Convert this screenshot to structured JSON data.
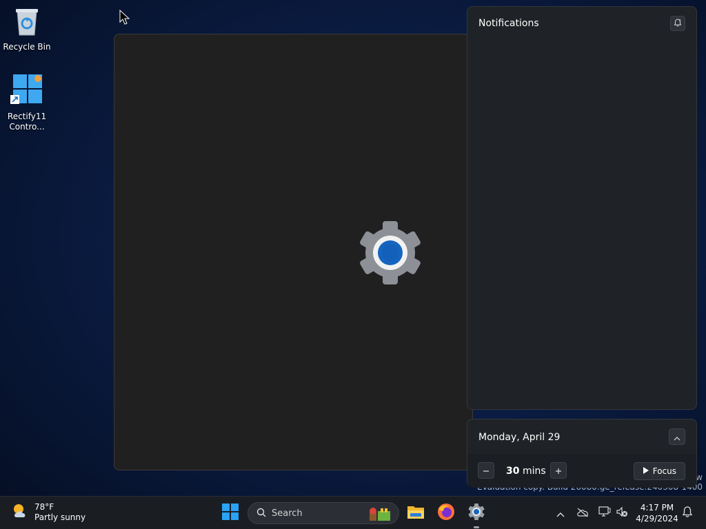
{
  "desktop": {
    "icons": [
      {
        "label": "Recycle Bin",
        "icon": "recycle-bin-icon"
      },
      {
        "label": "Rectify11\nContro...",
        "icon": "rectify11-control-center-icon"
      }
    ]
  },
  "settings_window": {
    "splash_icon": "settings-gear-icon"
  },
  "watermark": {
    "line1": "w",
    "line2": "Evaluation copy. Build 26080.ge_release.240308-1400"
  },
  "notifications": {
    "title": "Notifications",
    "dnd_icon": "do-not-disturb-icon"
  },
  "calendar": {
    "date": "Monday, April 29",
    "collapse_icon": "chevron-up-icon",
    "focus": {
      "minutes": "30",
      "unit": "mins",
      "button_label": "Focus"
    }
  },
  "taskbar": {
    "weather": {
      "temp": "78°F",
      "condition": "Partly sunny",
      "icon": "partly-sunny-icon"
    },
    "search_placeholder": "Search",
    "pinned": [
      "start-icon",
      "file-explorer-icon",
      "firefox-icon",
      "settings-icon"
    ],
    "tray": [
      "chevron-up-icon",
      "onedrive-icon",
      "network-icon",
      "volume-muted-icon"
    ],
    "clock": {
      "time": "4:17 PM",
      "date": "4/29/2024"
    },
    "notification_icon": "bell-icon"
  },
  "colors": {
    "accent": "#0f6cbd",
    "panel": "#1f2226",
    "window": "#202020",
    "taskbar": "#1a1d22"
  }
}
